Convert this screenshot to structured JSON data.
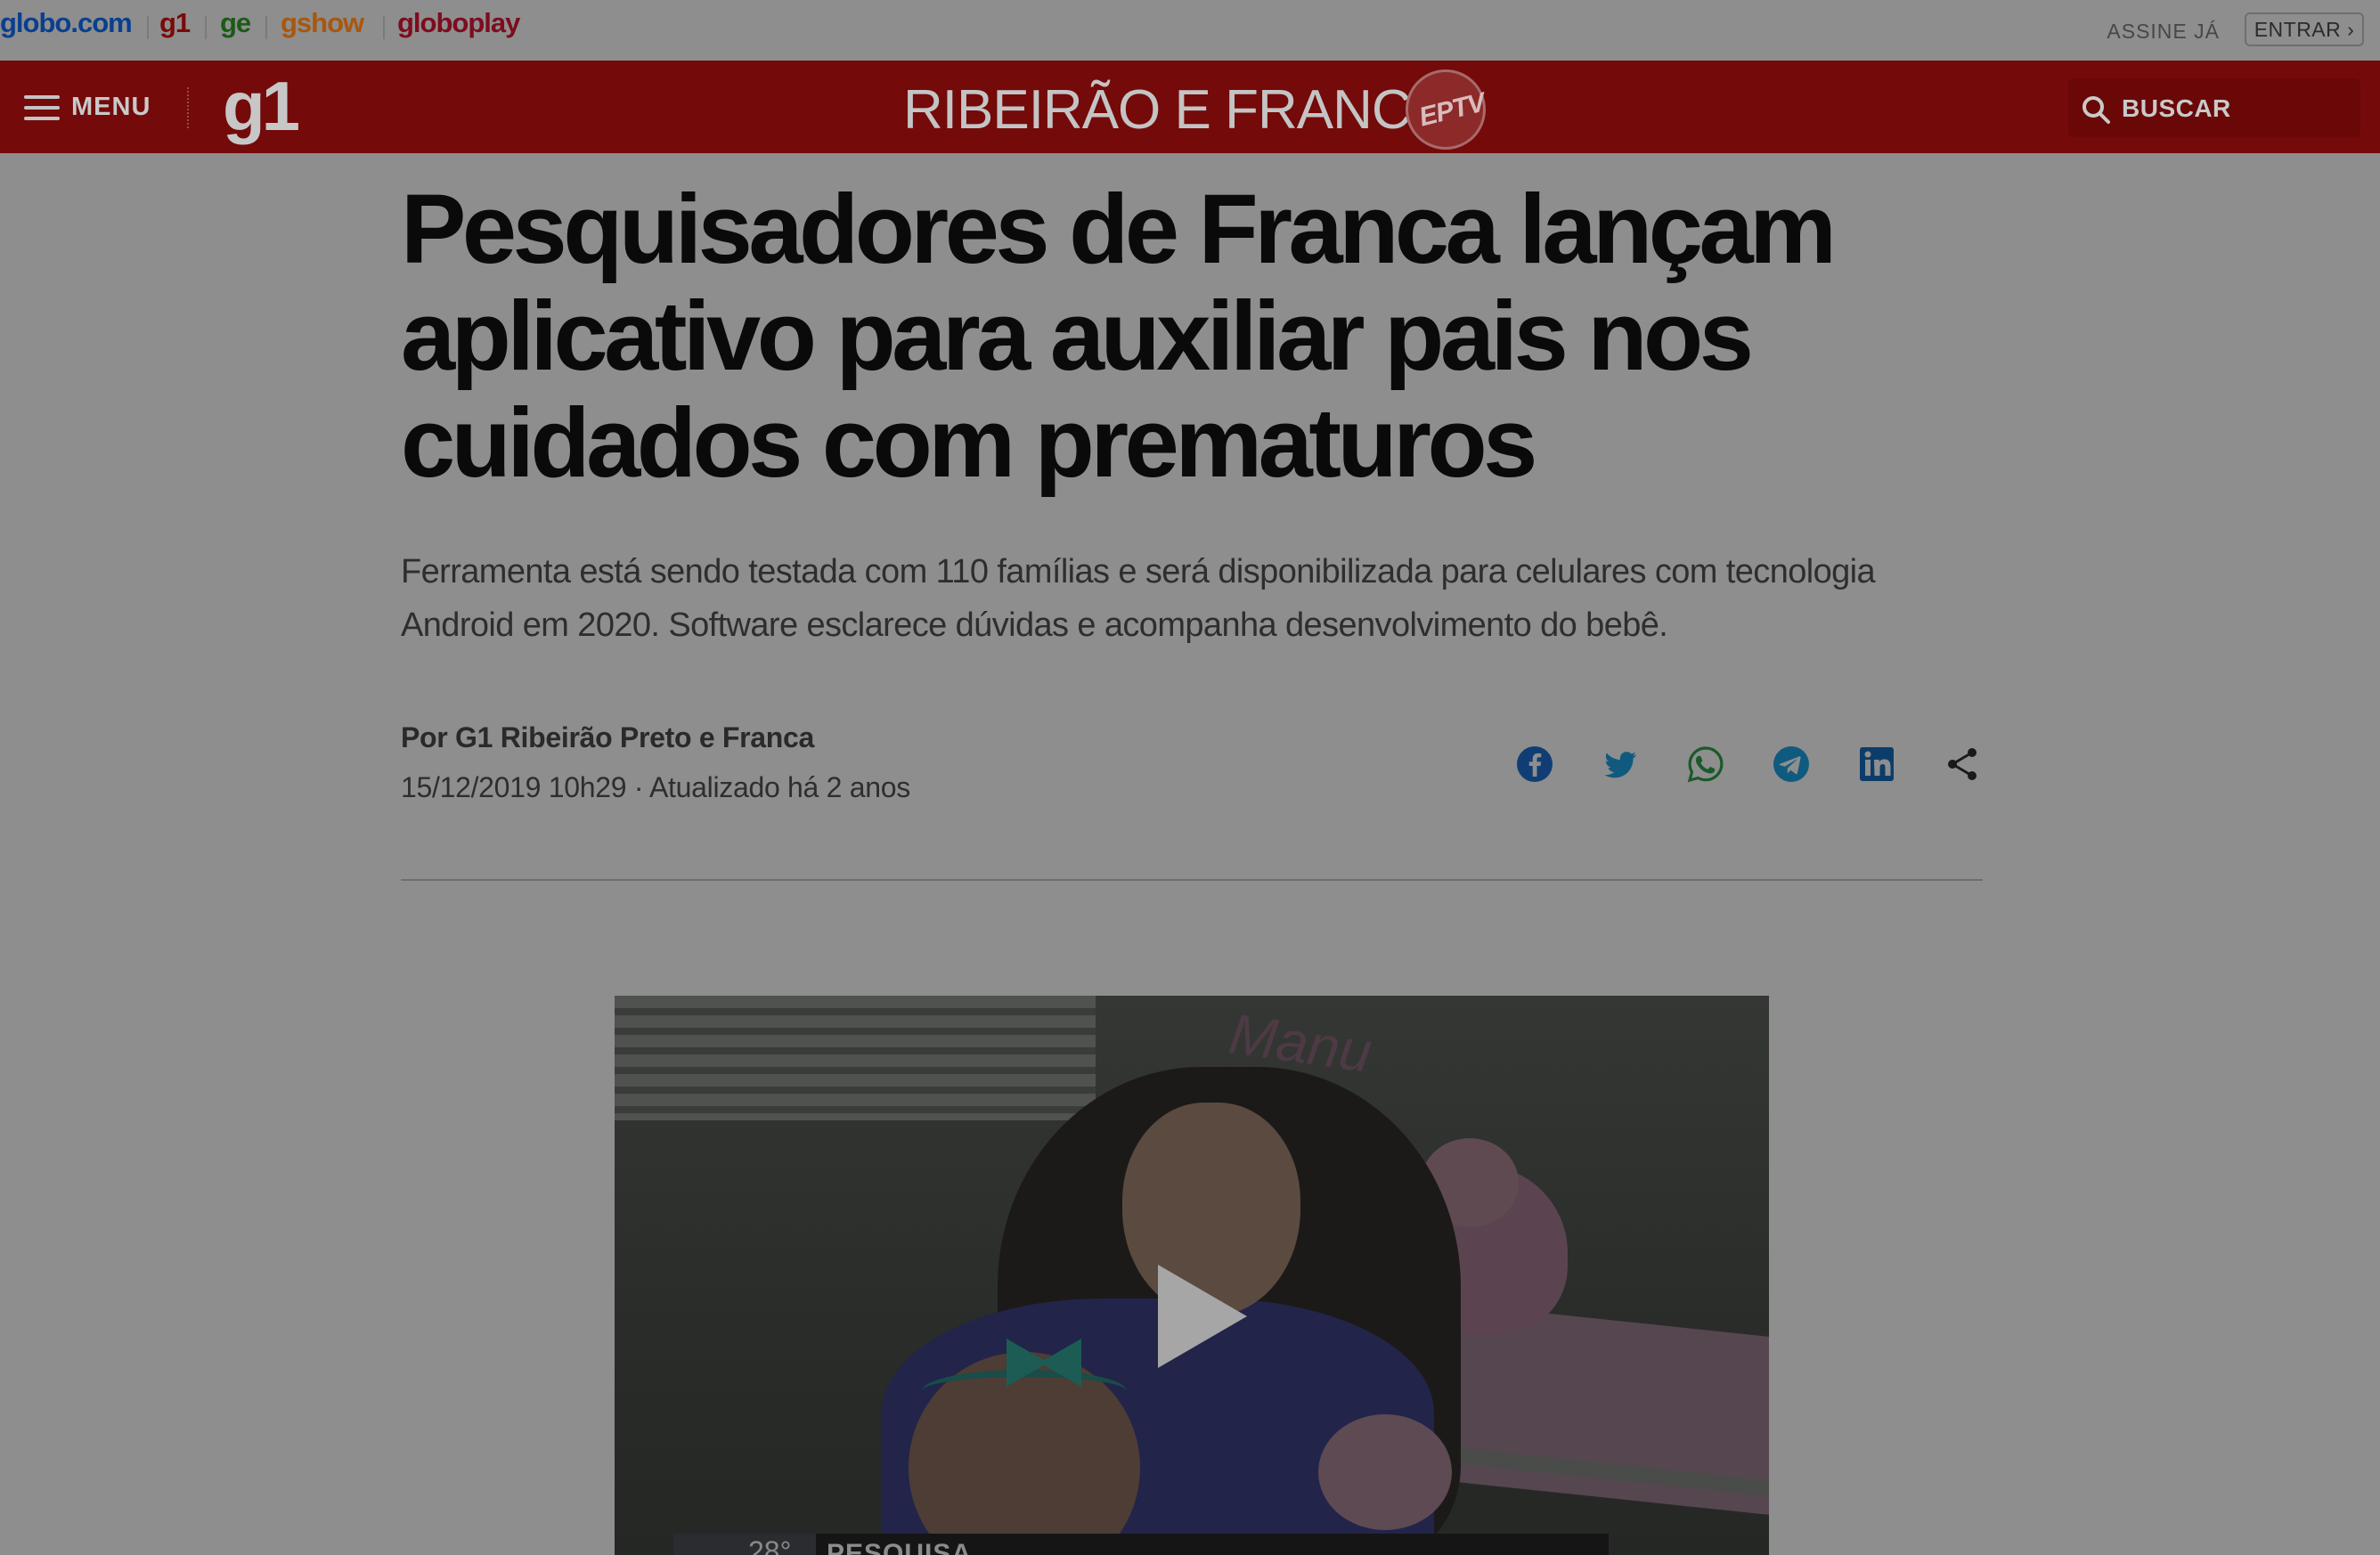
{
  "globo_bar": {
    "links": [
      {
        "label": "globo.com",
        "color": "#0a3f8f"
      },
      {
        "label": "g1",
        "color": "#7a0a0a"
      },
      {
        "label": "ge",
        "color": "#1c5a17"
      },
      {
        "label": "gshow",
        "color": "#a8570e"
      },
      {
        "label": "globoplay",
        "color": "#7d0c1e"
      }
    ],
    "assine_label": "ASSINE JÁ",
    "entrar_label": "ENTRAR ›"
  },
  "header": {
    "menu_label": "MENU",
    "logo_text": "g1",
    "region_title": "RIBEIRÃO E FRANCA",
    "affiliate_logo_text": "EPTV",
    "search_label": "BUSCAR",
    "background": "#740a0a"
  },
  "article": {
    "title": "Pesquisadores de Franca lançam aplicativo para auxiliar pais nos cuidados com prematuros",
    "subtitle": "Ferramenta está sendo testada com 110 famílias e será disponibilizada para celulares com tecnologia Android em 2020. Software esclarece dúvidas e acompanha desenvolvimento do bebê.",
    "byline": "Por G1 Ribeirão Preto e Franca",
    "dateline": "15/12/2019 10h29 · Atualizado há 2 anos"
  },
  "share_buttons": [
    {
      "icon": "facebook-icon",
      "color": "#103e74"
    },
    {
      "icon": "twitter-icon",
      "color": "#105a80"
    },
    {
      "icon": "whatsapp-icon",
      "color": "#1a5a2a"
    },
    {
      "icon": "telegram-icon",
      "color": "#105a80"
    },
    {
      "icon": "linkedin-icon",
      "color": "#0c3d6a"
    },
    {
      "icon": "share-icon",
      "color": "#1a1a1a"
    }
  ],
  "video": {
    "wall_text": "Manu",
    "weather_temp": "28°",
    "lower_third_text": "PESQUISA"
  }
}
